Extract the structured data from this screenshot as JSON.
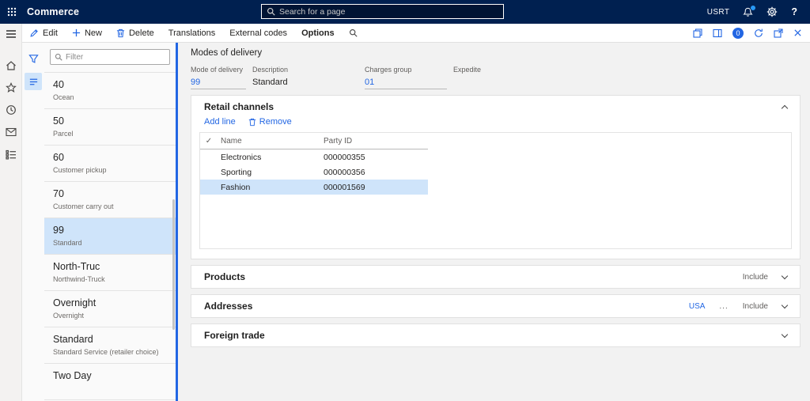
{
  "colors": {
    "topbar": "#002050",
    "accent": "#2266e3",
    "selection": "#cfe4fa"
  },
  "topbar": {
    "app_name": "Commerce",
    "search_placeholder": "Search for a page",
    "user": "USRT",
    "help": "?"
  },
  "actionbar": {
    "edit": "Edit",
    "new": "New",
    "delete": "Delete",
    "translations": "Translations",
    "external_codes": "External codes",
    "options": "Options",
    "message_count": "0"
  },
  "left_panel": {
    "filter_placeholder": "Filter",
    "records": [
      {
        "title": "40",
        "subtitle": "Ocean"
      },
      {
        "title": "50",
        "subtitle": "Parcel"
      },
      {
        "title": "60",
        "subtitle": "Customer pickup"
      },
      {
        "title": "70",
        "subtitle": "Customer carry out"
      },
      {
        "title": "99",
        "subtitle": "Standard"
      },
      {
        "title": "North-Truc",
        "subtitle": "Northwind-Truck"
      },
      {
        "title": "Overnight",
        "subtitle": "Overnight"
      },
      {
        "title": "Standard",
        "subtitle": "Standard Service (retailer choice)"
      },
      {
        "title": "Two Day",
        "subtitle": ""
      }
    ]
  },
  "page": {
    "title": "Modes of delivery",
    "fields": [
      {
        "label": "Mode of delivery",
        "value": "99"
      },
      {
        "label": "Description",
        "value": "Standard"
      },
      {
        "label": "Charges group",
        "value": "01"
      },
      {
        "label": "Expedite",
        "value": ""
      }
    ]
  },
  "retail_channels": {
    "title": "Retail channels",
    "add_line": "Add line",
    "remove": "Remove",
    "columns": {
      "check": "✓",
      "name": "Name",
      "party_id": "Party ID"
    },
    "rows": [
      {
        "name": "Electronics",
        "party_id": "000000355"
      },
      {
        "name": "Sporting",
        "party_id": "000000356"
      },
      {
        "name": "Fashion",
        "party_id": "000001569"
      }
    ]
  },
  "products": {
    "title": "Products",
    "include": "Include"
  },
  "addresses": {
    "title": "Addresses",
    "link": "USA",
    "more": "...",
    "include": "Include"
  },
  "foreign_trade": {
    "title": "Foreign trade"
  }
}
